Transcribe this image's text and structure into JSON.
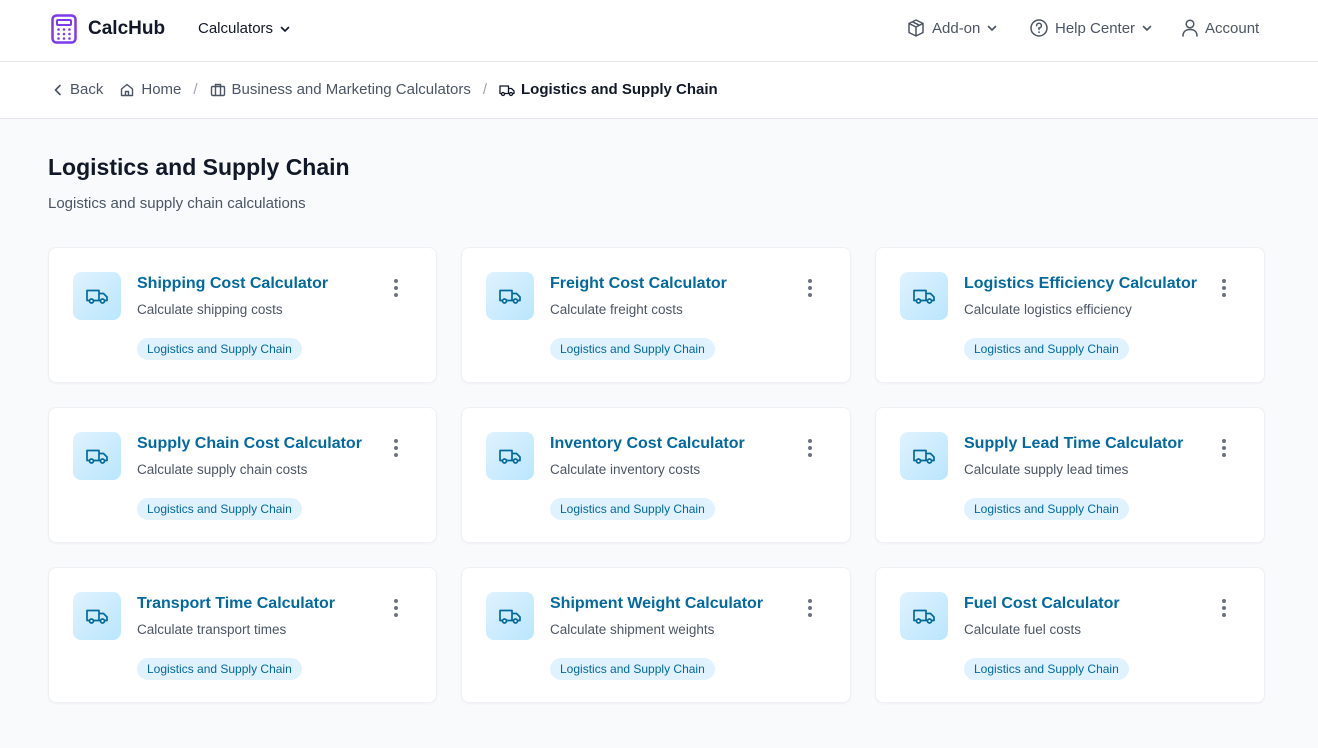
{
  "app": {
    "brand": "CalcHub"
  },
  "nav": {
    "calculators": "Calculators",
    "addon": "Add-on",
    "help": "Help Center",
    "account": "Account"
  },
  "breadcrumb": {
    "back": "Back",
    "home": "Home",
    "category": "Business and Marketing Calculators",
    "current": "Logistics and Supply Chain"
  },
  "page": {
    "title": "Logistics and Supply Chain",
    "subtitle": "Logistics and supply chain calculations"
  },
  "cards": [
    {
      "title": "Shipping Cost Calculator",
      "description": "Calculate shipping costs",
      "tag": "Logistics and Supply Chain"
    },
    {
      "title": "Freight Cost Calculator",
      "description": "Calculate freight costs",
      "tag": "Logistics and Supply Chain"
    },
    {
      "title": "Logistics Efficiency Calculator",
      "description": "Calculate logistics efficiency",
      "tag": "Logistics and Supply Chain"
    },
    {
      "title": "Supply Chain Cost Calculator",
      "description": "Calculate supply chain costs",
      "tag": "Logistics and Supply Chain"
    },
    {
      "title": "Inventory Cost Calculator",
      "description": "Calculate inventory costs",
      "tag": "Logistics and Supply Chain"
    },
    {
      "title": "Supply Lead Time Calculator",
      "description": "Calculate supply lead times",
      "tag": "Logistics and Supply Chain"
    },
    {
      "title": "Transport Time Calculator",
      "description": "Calculate transport times",
      "tag": "Logistics and Supply Chain"
    },
    {
      "title": "Shipment Weight Calculator",
      "description": "Calculate shipment weights",
      "tag": "Logistics and Supply Chain"
    },
    {
      "title": "Fuel Cost Calculator",
      "description": "Calculate fuel costs",
      "tag": "Logistics and Supply Chain"
    }
  ],
  "colors": {
    "brand": "#7c3aed",
    "accent": "#0369a1",
    "tag_bg": "#e0f2fe",
    "icon_bg": "#bae6fd"
  },
  "icons": {
    "logo": "calculator-icon",
    "card": "truck-icon",
    "menu": "more-vertical-icon"
  }
}
